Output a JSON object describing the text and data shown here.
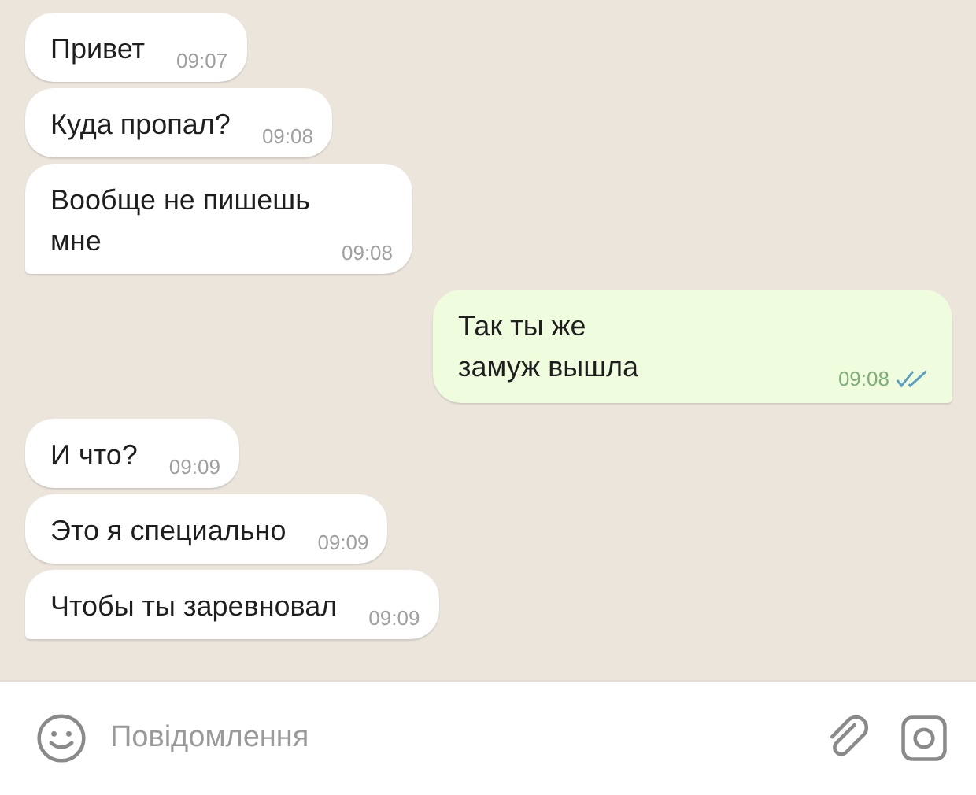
{
  "messages": [
    {
      "kind": "in",
      "text": "Привет",
      "time": "09:07",
      "tail": false
    },
    {
      "kind": "in",
      "text": "Куда пропал?",
      "time": "09:08",
      "tail": false
    },
    {
      "kind": "in",
      "text": "Вообще не пишешь\nмне",
      "time": "09:08",
      "tail": true
    },
    {
      "kind": "out",
      "text": "Так ты же\nзамуж вышла",
      "time": "09:08",
      "tail": true,
      "read": true
    },
    {
      "kind": "in",
      "text": "И что?",
      "time": "09:09",
      "tail": false
    },
    {
      "kind": "in",
      "text": "Это я специально",
      "time": "09:09",
      "tail": false
    },
    {
      "kind": "in",
      "text": "Чтобы ты заревновал",
      "time": "09:09",
      "tail": true
    }
  ],
  "composer": {
    "placeholder": "Повідомлення"
  }
}
